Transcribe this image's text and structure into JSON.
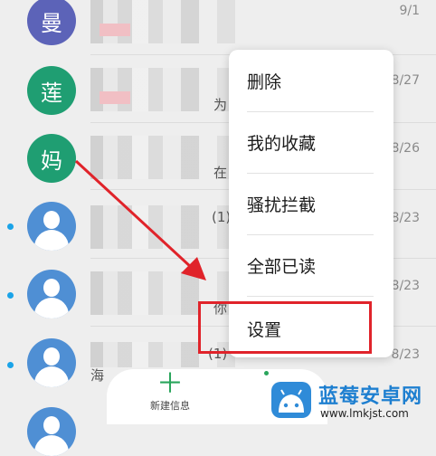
{
  "contacts": [
    {
      "avatar_text": "曼",
      "avatar_color": "#5c63b8",
      "snippet": "",
      "date": "9/1",
      "unread": false
    },
    {
      "avatar_text": "莲",
      "avatar_color": "#1f9e72",
      "snippet": "为",
      "date": "8/27",
      "unread": false
    },
    {
      "avatar_text": "妈",
      "avatar_color": "#1f9e72",
      "snippet": "在",
      "date": "8/26",
      "unread": false
    },
    {
      "avatar_text": "",
      "avatar_color": "#4f8fd4",
      "snippet": "(1)",
      "date": "8/23",
      "unread": true
    },
    {
      "avatar_text": "",
      "avatar_color": "#4f8fd4",
      "snippet": "你",
      "date": "8/23",
      "unread": true
    },
    {
      "avatar_text": "",
      "avatar_color": "#4f8fd4",
      "snippet": "(1)",
      "date": "8/23",
      "unread": true
    }
  ],
  "partial_sender": "海",
  "menu": {
    "items": [
      "删除",
      "我的收藏",
      "骚扰拦截",
      "全部已读",
      "设置"
    ]
  },
  "bottom_bar": {
    "new_message_label": "新建信息"
  },
  "watermark": {
    "title": "蓝莓安卓网",
    "url": "www.lmkjst.com"
  },
  "accent_colors": {
    "highlight": "#e0232a",
    "arrow": "#e0232a",
    "new_plus": "#2aa55c"
  }
}
